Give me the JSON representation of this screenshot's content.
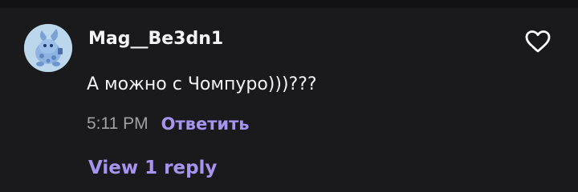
{
  "comment": {
    "username": "Mag__Be3dn1",
    "text": "А можно с Чомпуро)))???",
    "timestamp": "5:11 PM",
    "reply_label": "Ответить",
    "view_replies_label": "View 1 reply",
    "like_icon": "heart-outline-icon",
    "avatar_icon": "mascot-avatar"
  },
  "colors": {
    "background": "#1a1a1c",
    "text": "#f2f2f4",
    "muted": "#a0a0a6",
    "accent": "#a694f0"
  }
}
